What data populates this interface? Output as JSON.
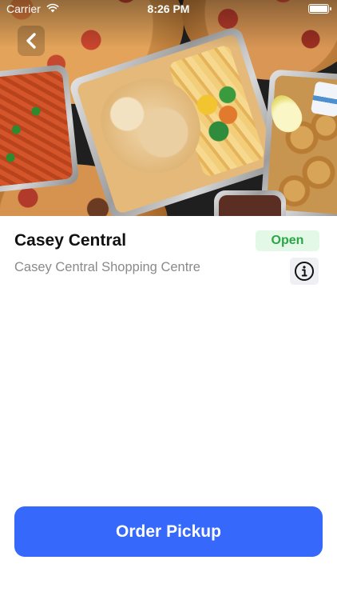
{
  "status_bar": {
    "carrier": "Carrier",
    "time": "8:26 PM",
    "wifi_icon": "wifi-icon",
    "battery_icon": "battery-icon",
    "battery_level": 1.0
  },
  "hero": {
    "image": "food-platter-photo"
  },
  "navigation": {
    "back_icon": "chevron-left-icon"
  },
  "store": {
    "name": "Casey Central",
    "status": "Open",
    "address": "Casey Central Shopping Centre",
    "info_icon": "info-circle-icon"
  },
  "actions": {
    "order_label": "Order Pickup"
  },
  "colors": {
    "accent": "#3568fb",
    "open_text": "#29a744",
    "open_bg": "#e4f8e8",
    "secondary_text": "#8a8a8e"
  }
}
